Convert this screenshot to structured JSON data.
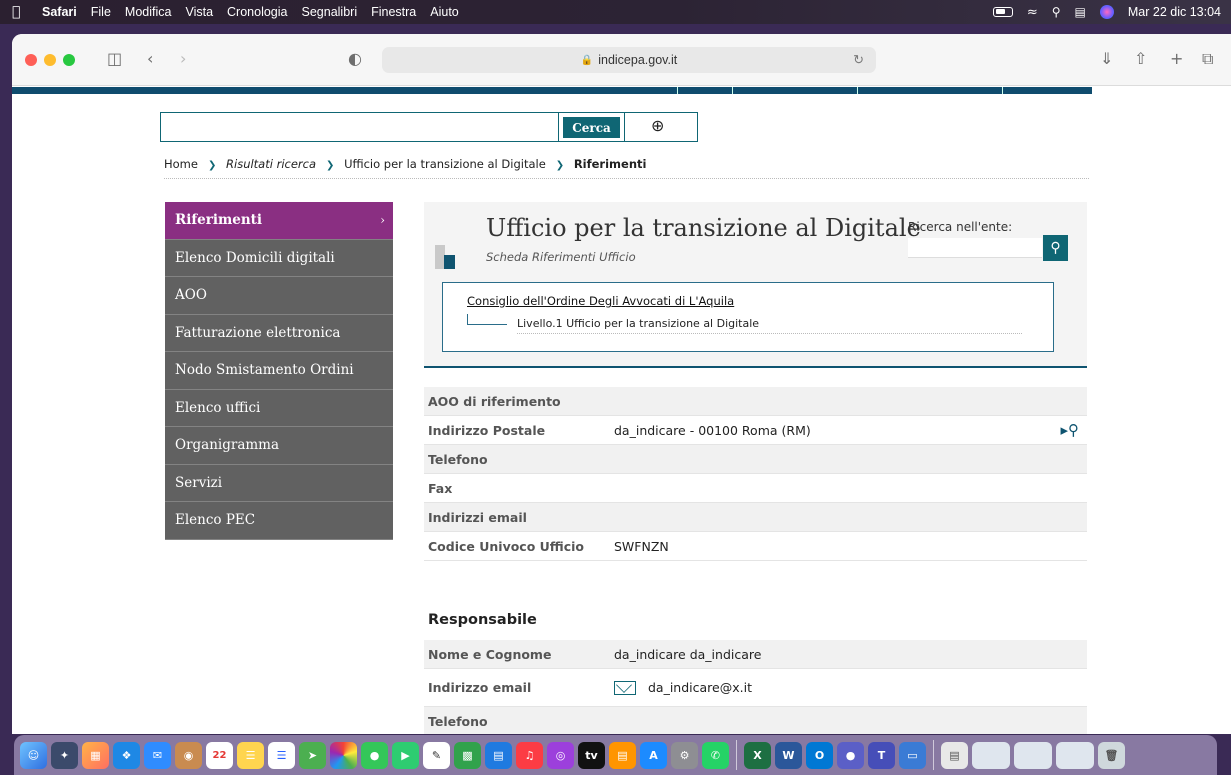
{
  "menubar": {
    "app": "Safari",
    "items": [
      "File",
      "Modifica",
      "Vista",
      "Cronologia",
      "Segnalibri",
      "Finestra",
      "Aiuto"
    ],
    "clock": "Mar 22 dic  13:04"
  },
  "browser": {
    "url": "indicepa.gov.it"
  },
  "search": {
    "button": "Cerca",
    "placeholder": ""
  },
  "breadcrumb": {
    "home": "Home",
    "results": "Risultati ricerca",
    "office": "Ufficio per la transizione al Digitale",
    "current": "Riferimenti"
  },
  "sidebar": {
    "items": [
      "Riferimenti",
      "Elenco Domicili digitali",
      "AOO",
      "Fatturazione elettronica",
      "Nodo Smistamento Ordini",
      "Elenco uffici",
      "Organigramma",
      "Servizi",
      "Elenco PEC"
    ]
  },
  "office": {
    "title": "Ufficio per la transizione al Digitale",
    "subtitle": "Scheda Riferimenti Ufficio",
    "ricerca_label": "Ricerca nell'ente:",
    "parent": "Consiglio dell'Ordine Degli Avvocati di L'Aquila",
    "child": "Livello.1 Ufficio per la transizione al Digitale"
  },
  "details": {
    "rows": [
      {
        "label": "AOO di riferimento",
        "value": ""
      },
      {
        "label": "Indirizzo Postale",
        "value": "da_indicare - 00100 Roma (RM)"
      },
      {
        "label": "Telefono",
        "value": ""
      },
      {
        "label": "Fax",
        "value": ""
      },
      {
        "label": "Indirizzi email",
        "value": ""
      },
      {
        "label": "Codice Univoco Ufficio",
        "value": "SWFNZN"
      }
    ]
  },
  "responsabile": {
    "title": "Responsabile",
    "rows": [
      {
        "label": "Nome e Cognome",
        "value": "da_indicare da_indicare"
      },
      {
        "label": "Indirizzo email",
        "value": "da_indicare@x.it"
      },
      {
        "label": "Telefono",
        "value": ""
      }
    ]
  },
  "dock": {
    "calendar_day": "22",
    "apps": [
      "Finder",
      "Launchpad",
      "Launchpad Grid",
      "Safari",
      "Mail",
      "Contacts",
      "Calendar",
      "Notes",
      "Reminders",
      "Maps",
      "Photos",
      "Messages",
      "FaceTime",
      "Freeform",
      "Numbers",
      "Keynote",
      "Music",
      "Podcasts",
      "TV",
      "Books",
      "App Store",
      "System Preferences",
      "WhatsApp",
      "Excel",
      "Word",
      "Outlook",
      "Teams Badge",
      "Teams",
      "Remote Desktop",
      "Preview",
      "Finder Window 1",
      "Finder Window 2",
      "Finder Window 3",
      "Trash"
    ]
  }
}
